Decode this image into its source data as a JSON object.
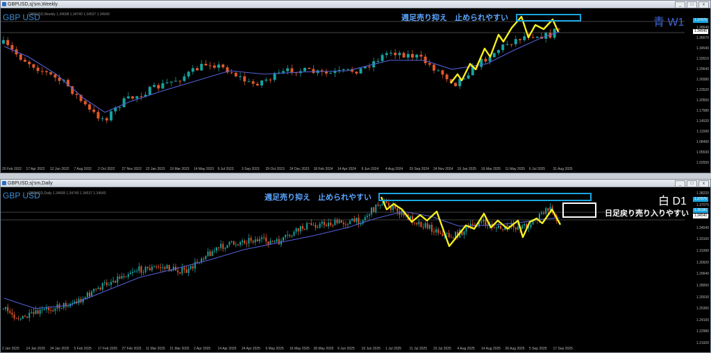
{
  "weekly": {
    "title": "GBPUSD,sj'sm,Weekly",
    "symbol": "GBP USD",
    "ohlc": "GBPUSD,Weekly  1.34608 1.34740 1.34537 1.34540",
    "annotation": "週足売り抑え　止められやすい",
    "timeframe": "青 W1",
    "timeframe_color": "#3f66d9",
    "price_labels": [
      "1.38640",
      "1.36670",
      "1.34540",
      "1.32610",
      "1.29640",
      "1.26580",
      "1.23520",
      "1.20550",
      "1.17580",
      "1.14520",
      "1.11560",
      "1.08490",
      "1.05530",
      "1.02550"
    ],
    "tag_prices": [
      "1.37075",
      "1.34540"
    ],
    "date_labels": [
      "20 Feb 2022",
      "17 Apr 2022",
      "12 Jun 2022",
      "7 Aug 2022",
      "2 Oct 2022",
      "27 Nov 2022",
      "22 Jan 2023",
      "19 Mar 2023",
      "14 May 2023",
      "9 Jul 2023",
      "3 Sep 2023",
      "29 Oct 2023",
      "24 Dec 2023",
      "18 Feb 2024",
      "14 Apr 2024",
      "9 Jun 2024",
      "4 Aug 2024",
      "29 Sep 2024",
      "24 Nov 2024",
      "19 Jan 2025",
      "16 Mar 2025",
      "11 May 2025",
      "6 Jul 2025",
      "31 Aug 2025"
    ]
  },
  "daily": {
    "title": "GBPUSD,sj'sm,Daily",
    "symbol": "GBP USD",
    "ohlc": "GBPUSD,Daily  1.34608 1.34740 1.34537 1.34540",
    "annotation": "週足売り抑え　止められやすい",
    "timeframe": "白 D1",
    "timeframe_color": "#ffffff",
    "note": "日足戻り売り入りやすい",
    "price_labels": [
      "1.38220",
      "1.37075",
      "1.35930",
      "1.34540",
      "1.33160",
      "1.31990",
      "1.30920",
      "1.29640",
      "1.28050",
      "1.26530",
      "1.25360",
      "1.24100",
      "1.22980",
      "1.21920"
    ],
    "tag_prices": [
      "1.37075",
      "1.35180",
      "1.34540"
    ],
    "date_labels": [
      "2 Jan 2025",
      "14 Jan 2025",
      "24 Jan 2025",
      "5 Feb 2025",
      "17 Feb 2025",
      "27 Feb 2025",
      "11 Mar 2025",
      "21 Mar 2025",
      "2 Apr 2025",
      "14 Apr 2025",
      "24 Apr 2025",
      "6 May 2025",
      "16 May 2025",
      "28 May 2025",
      "9 Jun 2025",
      "19 Jun 2025",
      "1 Jul 2025",
      "11 Jul 2025",
      "23 Jul 2025",
      "4 Aug 2025",
      "14 Aug 2025",
      "26 Aug 2025",
      "5 Sep 2025",
      "17 Sep 2025"
    ]
  },
  "colors": {
    "bull": "#16a3a0",
    "bear": "#e0582a",
    "ma": "#5560d8",
    "zigzag": "#f5ef1e",
    "zone": "#1aa6e0"
  },
  "window_buttons": {
    "minimize": "_",
    "maximize": "□",
    "close": "x"
  }
}
